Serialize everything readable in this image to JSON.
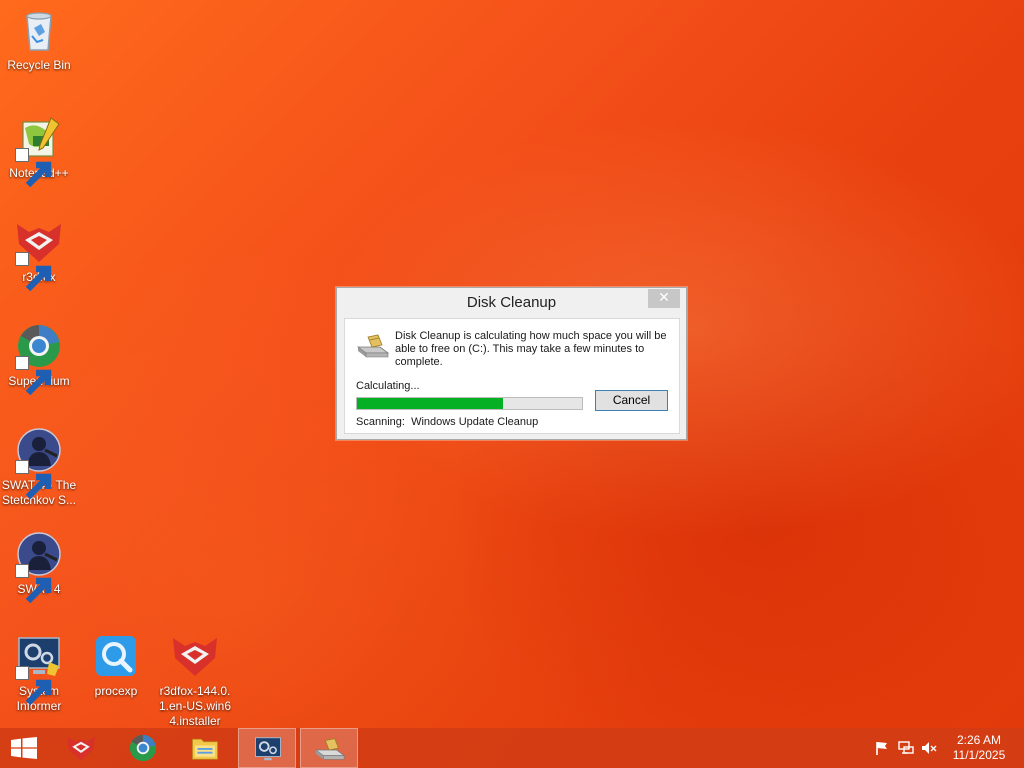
{
  "desktop": {
    "icons": [
      {
        "label": "Recycle Bin",
        "icon": "recycle-bin-icon"
      },
      {
        "label": "Notepad++",
        "icon": "notepad-plus-plus-icon"
      },
      {
        "label": "r3dfox",
        "icon": "r3dfox-icon"
      },
      {
        "label": "Supermium",
        "icon": "supermium-icon"
      },
      {
        "label": "SWAT 4 - The Stetchkov S...",
        "icon": "swat4-expansion-icon"
      },
      {
        "label": "SWAT 4",
        "icon": "swat4-icon"
      },
      {
        "label": "System Informer",
        "icon": "system-informer-icon"
      },
      {
        "label": "procexp",
        "icon": "procexp-icon"
      },
      {
        "label": "r3dfox-144.0.1.en-US.win64.installer",
        "icon": "r3dfox-installer-icon"
      }
    ]
  },
  "dialog": {
    "title": "Disk Cleanup",
    "close_label": "✕",
    "message": "Disk Cleanup is calculating how much space you will be able to free on  (C:). This may take a few minutes to complete.",
    "status": "Calculating...",
    "progress_percent": 65,
    "scanning_label": "Scanning:",
    "scanning_item": "Windows Update Cleanup",
    "cancel_label": "Cancel",
    "progress_color": "#06b025"
  },
  "taskbar": {
    "items": [
      "start-icon",
      "r3dfox-icon",
      "supermium-icon",
      "file-explorer-icon",
      "system-informer-icon",
      "disk-cleanup-icon"
    ],
    "tray": [
      "flag-icon",
      "network-icon",
      "volume-muted-icon"
    ],
    "time": "2:26 AM",
    "date": "11/1/2025"
  }
}
